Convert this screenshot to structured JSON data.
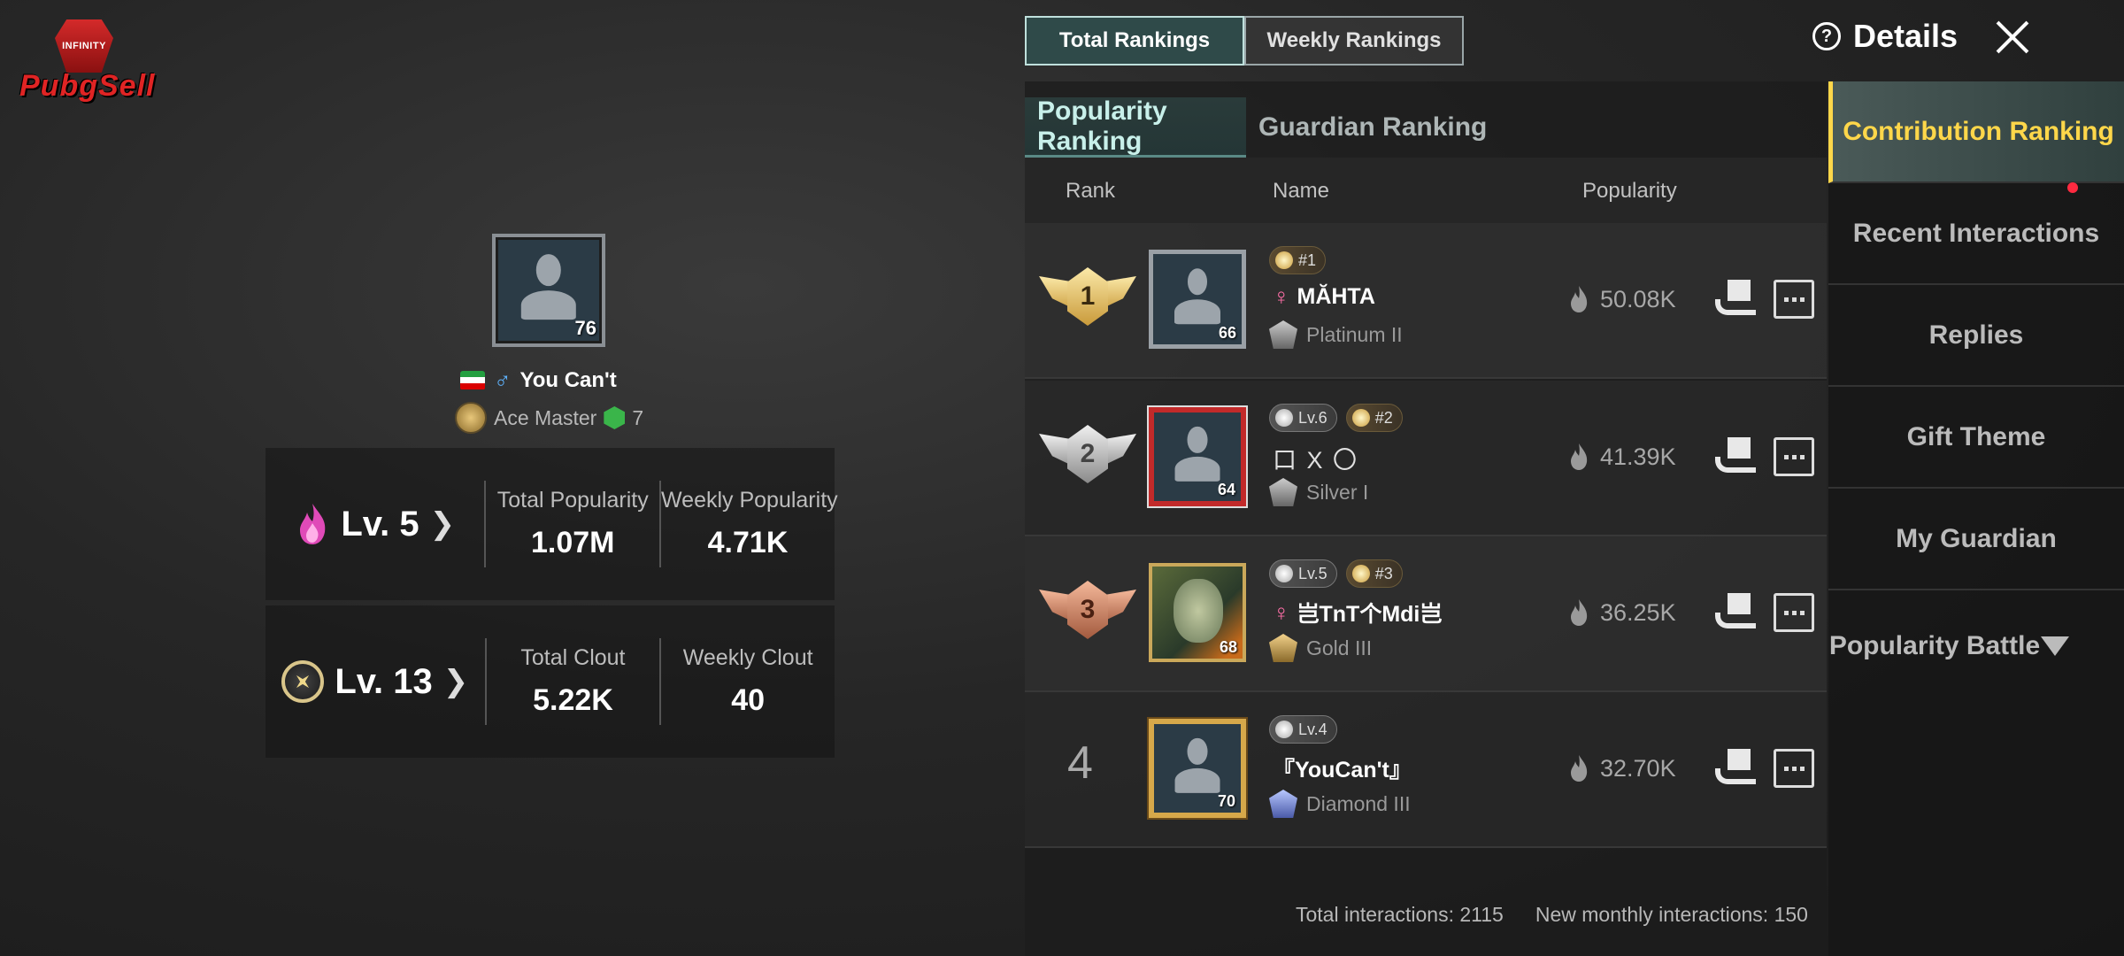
{
  "watermark": {
    "shield_text": "INFINITY",
    "brand": "PubgSell"
  },
  "profile": {
    "level_badge": "76",
    "name": "You Can't",
    "tier": "Ace Master",
    "tier_stars": "7",
    "stats": [
      {
        "level": "Lv. 5",
        "left_label": "Total Popularity",
        "left_value": "1.07M",
        "right_label": "Weekly Popularity",
        "right_value": "4.71K"
      },
      {
        "level": "Lv. 13",
        "left_label": "Total Clout",
        "left_value": "5.22K",
        "right_label": "Weekly Clout",
        "right_value": "40"
      }
    ]
  },
  "top_tabs": {
    "total": "Total Rankings",
    "weekly": "Weekly Rankings",
    "active": "Total Rankings"
  },
  "header": {
    "details": "Details"
  },
  "sub_tabs": {
    "popularity": "Popularity Ranking",
    "guardian": "Guardian Ranking",
    "active": "Popularity Ranking"
  },
  "columns": {
    "rank": "Rank",
    "name": "Name",
    "popularity": "Popularity"
  },
  "rows": [
    {
      "rank": "1",
      "avatar_level": "66",
      "badges": [
        "#1"
      ],
      "name": "MĂHTA",
      "tier": "Platinum II",
      "popularity": "50.08K"
    },
    {
      "rank": "2",
      "avatar_level": "64",
      "badges": [
        "Lv.6",
        "#2"
      ],
      "name": "口 X 〇",
      "tier": "Silver I",
      "popularity": "41.39K"
    },
    {
      "rank": "3",
      "avatar_level": "68",
      "badges": [
        "Lv.5",
        "#3"
      ],
      "name": "岂TnT个Mdi岂",
      "tier": "Gold III",
      "popularity": "36.25K"
    },
    {
      "rank": "4",
      "avatar_level": "70",
      "badges": [
        "Lv.4"
      ],
      "name": "『YouCan't』",
      "tier": "Diamond III",
      "popularity": "32.70K"
    }
  ],
  "footer": {
    "total_interactions": "Total interactions: 2115",
    "monthly_interactions": "New monthly interactions: 150"
  },
  "sidebar": {
    "items": [
      "Contribution Ranking",
      "Recent Interactions",
      "Replies",
      "Gift Theme",
      "My Guardian"
    ],
    "dropdown": "Popularity Battle",
    "active": "Contribution Ranking"
  },
  "colors": {
    "accent_teal": "#2f4a49",
    "active_yellow": "#ffd74a",
    "notification_red": "#ff2a40"
  }
}
